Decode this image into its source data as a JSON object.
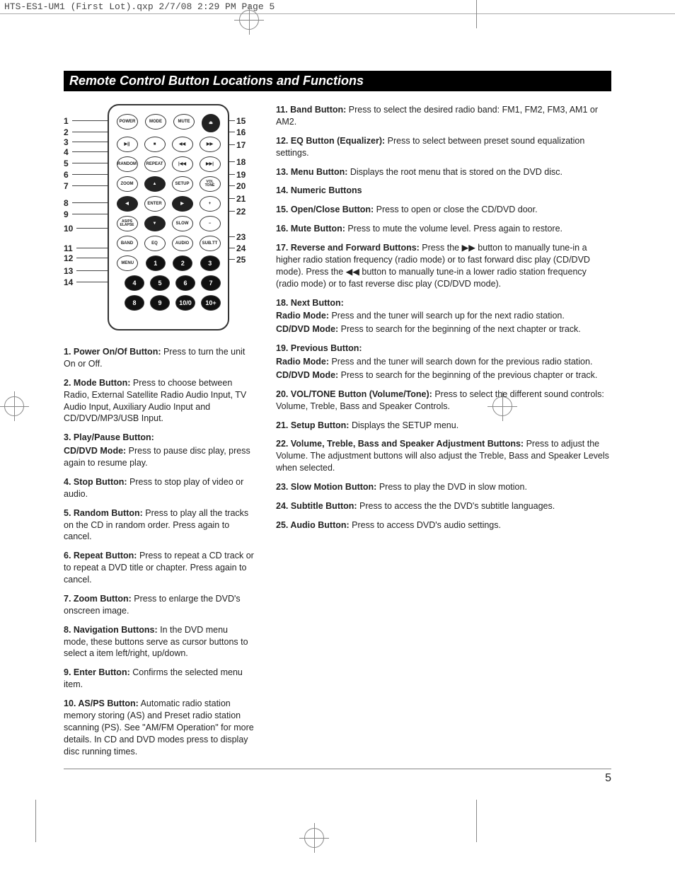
{
  "header_slug": "HTS-ES1-UM1 (First Lot).qxp  2/7/08  2:29 PM  Page 5",
  "section_title": "Remote Control Button Locations and Functions",
  "page_number": "5",
  "remote": {
    "leftLabels": [
      "1",
      "2",
      "3",
      "4",
      "5",
      "6",
      "7",
      "8",
      "9",
      "10",
      "11",
      "12",
      "13",
      "14"
    ],
    "rightLabels": [
      "15",
      "16",
      "17",
      "18",
      "19",
      "20",
      "21",
      "22",
      "23",
      "24",
      "25"
    ],
    "rows": {
      "r1": [
        "POWER",
        "MODE",
        "MUTE",
        "⏏"
      ],
      "r2": [
        "▶||",
        "■",
        "◀◀",
        "▶▶"
      ],
      "r3": [
        "RANDOM",
        "REPEAT",
        "|◀◀",
        "▶▶|"
      ],
      "r4": [
        "ZOOM",
        "▲",
        "SETUP",
        "VOL\nTONE"
      ],
      "r5": [
        "◀",
        "ENTER",
        "▶",
        "+"
      ],
      "r6": [
        "AS/PS\nELAPSE",
        "▼",
        "SLOW",
        "−"
      ],
      "r7": [
        "BAND",
        "EQ",
        "AUDIO",
        "SUB.TT"
      ],
      "r8": [
        "MENU",
        "1",
        "2",
        "3"
      ],
      "r9": [
        "4",
        "5",
        "6",
        "7"
      ],
      "r10": [
        "8",
        "9",
        "10/0",
        "10+"
      ]
    }
  },
  "left_items": [
    {
      "t": "1. Power On/Of Button:",
      "d": " Press to turn the unit On or Off."
    },
    {
      "t": "2. Mode Button:",
      "d": " Press to choose between Radio, External Satellite Radio Audio Input, TV Audio Input, Auxiliary Audio Input and CD/DVD/MP3/USB Input."
    },
    {
      "t": "3. Play/Pause Button:",
      "d": "",
      "sub": [
        {
          "t": "CD/DVD Mode:",
          "d": " Press to pause disc play, press again to resume play."
        }
      ]
    },
    {
      "t": "4. Stop Button:",
      "d": " Press to stop play of video or audio."
    },
    {
      "t": "5. Random Button:",
      "d": " Press to play all the tracks on the CD in random order. Press again to cancel."
    },
    {
      "t": "6. Repeat Button:",
      "d": " Press to repeat a CD track or to repeat a DVD title or chapter. Press again to cancel."
    },
    {
      "t": "7. Zoom Button:",
      "d": " Press to enlarge the DVD's onscreen image."
    },
    {
      "t": "8. Navigation Buttons:",
      "d": " In the DVD menu mode, these buttons serve as cursor buttons to select a item left/right, up/down."
    },
    {
      "t": "9. Enter Button:",
      "d": " Confirms the selected menu item."
    },
    {
      "t": "10. AS/PS Button:",
      "d": " Automatic radio station memory storing (AS) and Preset radio station scanning (PS). See \"AM/FM Operation\" for more details. In CD and DVD modes press to display disc running times."
    }
  ],
  "right_items": [
    {
      "t": "11. Band Button:",
      "d": " Press to select the desired radio band: FM1, FM2, FM3, AM1 or AM2."
    },
    {
      "t": "12. EQ Button (Equalizer):",
      "d": " Press to select between preset sound equalization settings."
    },
    {
      "t": "13. Menu Button:",
      "d": " Displays the root menu that is stored on the DVD disc."
    },
    {
      "t": "14. Numeric Buttons",
      "d": ""
    },
    {
      "t": "15. Open/Close Button:",
      "d": " Press to open or close the CD/DVD door."
    },
    {
      "t": "16. Mute Button:",
      "d": " Press to mute the volume level. Press again to restore."
    },
    {
      "t": "17. Reverse and Forward Buttons:",
      "d_pre": " Press the ",
      "d_mid": " button to manually tune-in a higher radio station frequency (radio mode) or to fast forward disc play (CD/DVD mode). Press the ",
      "d_post": " button to manually tune-in a lower radio station frequency (radio mode) or to fast reverse disc play (CD/DVD mode)."
    },
    {
      "t": "18. Next Button:",
      "d": "",
      "sub": [
        {
          "t": "Radio Mode:",
          "d": " Press and the tuner will search up for the next radio station."
        },
        {
          "t": "CD/DVD Mode:",
          "d": " Press to search for the beginning of the next chapter or track."
        }
      ]
    },
    {
      "t": "19. Previous Button:",
      "d": "",
      "sub": [
        {
          "t": "Radio Mode:",
          "d": " Press and the tuner will search down for the previous radio station."
        },
        {
          "t": "CD/DVD Mode:",
          "d": " Press to search for the beginning of the previous chapter or track."
        }
      ]
    },
    {
      "t": "20. VOL/TONE Button (Volume/Tone):",
      "d": " Press to select the different sound controls: Volume, Treble, Bass and Speaker Controls."
    },
    {
      "t": "21. Setup Button:",
      "d": " Displays the SETUP menu."
    },
    {
      "t": "22. Volume, Treble, Bass and Speaker Adjustment Buttons:",
      "d": " Press to adjust the Volume. The adjustment buttons will also adjust the Treble, Bass and Speaker Levels when selected."
    },
    {
      "t": "23. Slow Motion Button:",
      "d": " Press to play the DVD in slow motion."
    },
    {
      "t": "24. Subtitle Button:",
      "d": " Press to access the the DVD's subtitle languages."
    },
    {
      "t": "25. Audio Button:",
      "d": " Press to access DVD's audio settings."
    }
  ]
}
